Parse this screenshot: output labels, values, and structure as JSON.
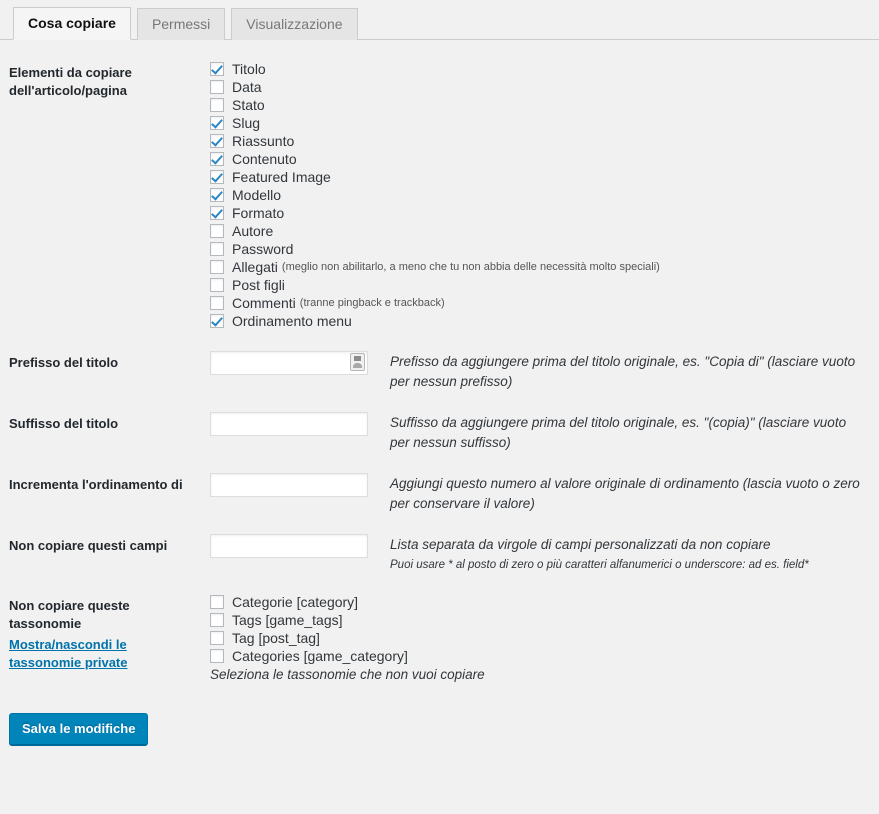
{
  "tabs": [
    {
      "label": "Cosa copiare",
      "active": true
    },
    {
      "label": "Permessi",
      "active": false
    },
    {
      "label": "Visualizzazione",
      "active": false
    }
  ],
  "sections": {
    "copy_elements": {
      "label_line1": "Elementi da copiare",
      "label_line2": "dell'articolo/pagina",
      "items": [
        {
          "label": "Titolo",
          "checked": true,
          "hint": ""
        },
        {
          "label": "Data",
          "checked": false,
          "hint": ""
        },
        {
          "label": "Stato",
          "checked": false,
          "hint": ""
        },
        {
          "label": "Slug",
          "checked": true,
          "hint": ""
        },
        {
          "label": "Riassunto",
          "checked": true,
          "hint": ""
        },
        {
          "label": "Contenuto",
          "checked": true,
          "hint": ""
        },
        {
          "label": "Featured Image",
          "checked": true,
          "hint": ""
        },
        {
          "label": "Modello",
          "checked": true,
          "hint": ""
        },
        {
          "label": "Formato",
          "checked": true,
          "hint": ""
        },
        {
          "label": "Autore",
          "checked": false,
          "hint": ""
        },
        {
          "label": "Password",
          "checked": false,
          "hint": ""
        },
        {
          "label": "Allegati",
          "checked": false,
          "hint": "(meglio non abilitarlo, a meno che tu non abbia delle necessità molto speciali)"
        },
        {
          "label": "Post figli",
          "checked": false,
          "hint": ""
        },
        {
          "label": "Commenti",
          "checked": false,
          "hint": "(tranne pingback e trackback)"
        },
        {
          "label": "Ordinamento menu",
          "checked": true,
          "hint": ""
        }
      ]
    },
    "title_prefix": {
      "label": "Prefisso del titolo",
      "value": "",
      "description": "Prefisso da aggiungere prima del titolo originale, es. \"Copia di\" (lasciare vuoto per nessun prefisso)",
      "autofill_icon": "password-manager-icon"
    },
    "title_suffix": {
      "label": "Suffisso del titolo",
      "value": "",
      "description": "Suffisso da aggiungere prima del titolo originale, es. \"(copia)\" (lasciare vuoto per nessun suffisso)"
    },
    "menu_order_increment": {
      "label": "Incrementa l'ordinamento di",
      "value": "",
      "description": "Aggiungi questo numero al valore originale di ordinamento (lascia vuoto o zero per conservare il valore)"
    },
    "skip_fields": {
      "label": "Non copiare questi campi",
      "value": "",
      "description": "Lista separata da virgole di campi personalizzati da non copiare",
      "description_small": "Puoi usare * al posto di zero o più caratteri alfanumerici o underscore: ad es. field*"
    },
    "skip_taxonomies": {
      "label_line1": "Non copiare queste",
      "label_line2": "tassonomie",
      "toggle_link": "Mostra/nascondi le tassonomie private",
      "items": [
        {
          "label": "Categorie [category]",
          "checked": false
        },
        {
          "label": "Tags [game_tags]",
          "checked": false
        },
        {
          "label": "Tag [post_tag]",
          "checked": false
        },
        {
          "label": "Categories [game_category]",
          "checked": false
        }
      ],
      "description": "Seleziona le tassonomie che non vuoi copiare"
    }
  },
  "submit": {
    "label": "Salva le modifiche"
  },
  "colors": {
    "page_background": "#f1f1f1",
    "accent_blue": "#0085ba",
    "link_blue": "#0073aa",
    "checkbox_check": "#2b87c4",
    "tab_active_background": "#f5f5f5",
    "tab_inactive_background": "#e5e5e5",
    "border_gray": "#cccccc"
  }
}
